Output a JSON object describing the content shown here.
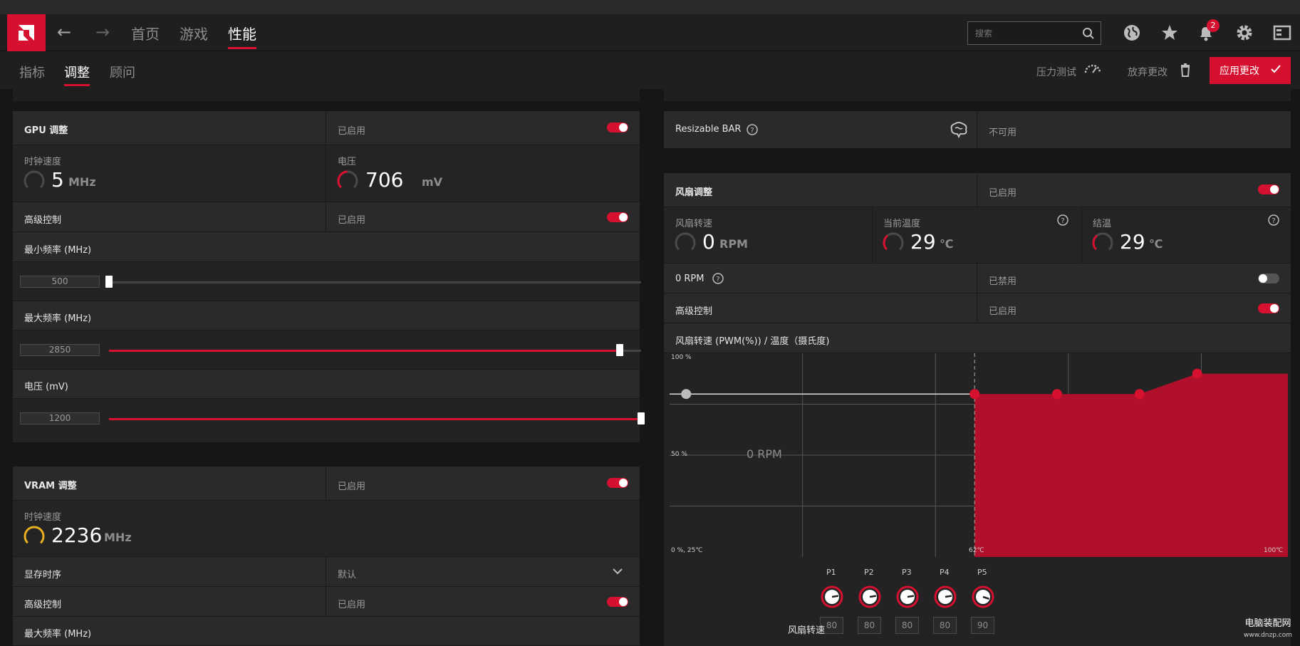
{
  "topbar": {
    "tabs": [
      {
        "label": "首页"
      },
      {
        "label": "游戏"
      },
      {
        "label": "性能"
      }
    ],
    "search_placeholder": "搜索",
    "notification_count": "2"
  },
  "subbar": {
    "tabs": [
      {
        "label": "指标"
      },
      {
        "label": "调整"
      },
      {
        "label": "顾问"
      }
    ],
    "stress_test": "压力测试",
    "discard": "放弃更改",
    "apply": "应用更改"
  },
  "gpu": {
    "title": "GPU 调整",
    "status": "已启用",
    "clock_label": "时钟速度",
    "clock_value": "5",
    "clock_unit": "MHz",
    "voltage_label": "电压",
    "voltage_value": "706",
    "voltage_unit": "mV",
    "advanced_label": "高级控制",
    "advanced_status": "已启用",
    "min_freq_label": "最小频率 (MHz)",
    "min_freq_value": "500",
    "min_freq_fraction": 0.0,
    "max_freq_label": "最大频率 (MHz)",
    "max_freq_value": "2850",
    "max_freq_fraction": 0.96,
    "volt_slider_label": "电压 (mV)",
    "volt_slider_value": "1200",
    "volt_slider_fraction": 1.0
  },
  "vram": {
    "title": "VRAM 调整",
    "status": "已启用",
    "clock_label": "时钟速度",
    "clock_value": "2236",
    "clock_unit": "MHz",
    "timing_label": "显存时序",
    "timing_value": "默认",
    "advanced_label": "高级控制",
    "advanced_status": "已启用",
    "max_freq_label": "最大频率 (MHz)"
  },
  "rebar": {
    "title": "Resizable BAR",
    "status": "不可用"
  },
  "fan": {
    "title": "风扇调整",
    "status": "已启用",
    "speed_label": "风扇转速",
    "speed_value": "0",
    "speed_unit": "RPM",
    "temp_label": "当前温度",
    "temp_value": "29",
    "temp_unit": "℃",
    "junction_label": "结温",
    "junction_value": "29",
    "junction_unit": "℃",
    "zero_rpm_label": "0 RPM",
    "zero_rpm_status": "已禁用",
    "advanced_label": "高级控制",
    "advanced_status": "已启用",
    "curve_title": "风扇转速 (PWM(%)) / 温度（摄氏度)",
    "curve_label": "0 RPM",
    "points_label": "风扇转速",
    "points": [
      {
        "name": "P1",
        "value": "80"
      },
      {
        "name": "P2",
        "value": "80"
      },
      {
        "name": "P3",
        "value": "80"
      },
      {
        "name": "P4",
        "value": "80"
      },
      {
        "name": "P5",
        "value": "90"
      }
    ]
  },
  "chart_data": {
    "type": "area",
    "title": "风扇转速 (PWM(%)) / 温度（摄氏度)",
    "x_tick_labels": [
      "0 %, 25℃",
      "62℃",
      "100℃"
    ],
    "y_tick_labels": [
      "100 %",
      "50 %"
    ],
    "xlim": [
      25,
      100
    ],
    "ylim": [
      0,
      100
    ],
    "zero_rpm_threshold_temp": 62,
    "x": [
      62,
      72,
      82,
      89
    ],
    "values": [
      80,
      80,
      80,
      90
    ]
  },
  "watermark": {
    "line1": "电脑装配网",
    "line2": "www.dnzp.com"
  },
  "colors": {
    "accent": "#d6102f",
    "vram_gauge": "#e6b020"
  }
}
